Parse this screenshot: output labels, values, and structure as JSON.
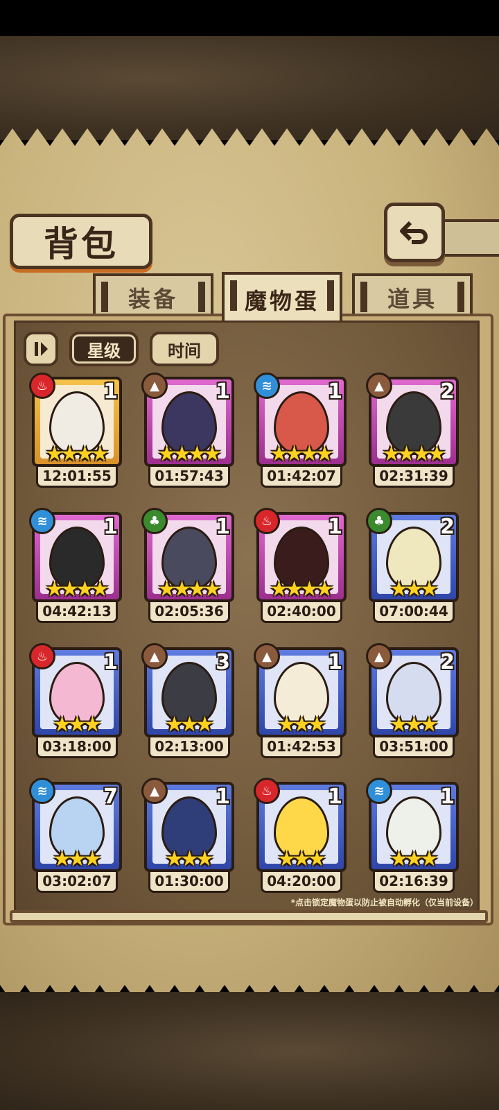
{
  "header": {
    "title": "背包",
    "back_icon": "return-arrow-icon"
  },
  "tabs": [
    {
      "label": "装备",
      "active": false
    },
    {
      "label": "魔物蛋",
      "active": true
    },
    {
      "label": "道具",
      "active": false
    }
  ],
  "sort": {
    "toggle_icon": "sort-direction-icon",
    "options": [
      {
        "label": "星级",
        "active": true
      },
      {
        "label": "时间",
        "active": false
      }
    ]
  },
  "eggs": [
    {
      "element": "fire",
      "frame": "gold",
      "count": "1",
      "stars": 4,
      "timer": "12:01:55",
      "egg_color": "#f0ece4"
    },
    {
      "element": "earth",
      "frame": "purple",
      "count": "1",
      "stars": 4,
      "timer": "01:57:43",
      "egg_color": "#3b3760"
    },
    {
      "element": "water",
      "frame": "purple",
      "count": "1",
      "stars": 4,
      "timer": "01:42:07",
      "egg_color": "#d8584a"
    },
    {
      "element": "earth",
      "frame": "purple",
      "count": "2",
      "stars": 4,
      "timer": "02:31:39",
      "egg_color": "#3a3a3a"
    },
    {
      "element": "water",
      "frame": "purple",
      "count": "1",
      "stars": 4,
      "timer": "04:42:13",
      "egg_color": "#2a2a2a"
    },
    {
      "element": "wood",
      "frame": "purple",
      "count": "1",
      "stars": 4,
      "timer": "02:05:36",
      "egg_color": "#4a4a5e"
    },
    {
      "element": "fire",
      "frame": "purple",
      "count": "1",
      "stars": 4,
      "timer": "02:40:00",
      "egg_color": "#3a1c1c"
    },
    {
      "element": "wood",
      "frame": "blue",
      "count": "2",
      "stars": 3,
      "timer": "07:00:44",
      "egg_color": "#efe8bf"
    },
    {
      "element": "fire",
      "frame": "blue",
      "count": "1",
      "stars": 3,
      "timer": "03:18:00",
      "egg_color": "#f4b8d2"
    },
    {
      "element": "earth",
      "frame": "blue",
      "count": "3",
      "stars": 3,
      "timer": "02:13:00",
      "egg_color": "#3c3c44"
    },
    {
      "element": "earth",
      "frame": "blue",
      "count": "1",
      "stars": 3,
      "timer": "01:42:53",
      "egg_color": "#f5ecd8"
    },
    {
      "element": "earth",
      "frame": "blue",
      "count": "2",
      "stars": 3,
      "timer": "03:51:00",
      "egg_color": "#d6dcf0"
    },
    {
      "element": "water",
      "frame": "blue",
      "count": "7",
      "stars": 3,
      "timer": "03:02:07",
      "egg_color": "#b9d4f2"
    },
    {
      "element": "earth",
      "frame": "blue",
      "count": "1",
      "stars": 3,
      "timer": "01:30:00",
      "egg_color": "#2f3d78"
    },
    {
      "element": "fire",
      "frame": "blue",
      "count": "1",
      "stars": 3,
      "timer": "04:20:00",
      "egg_color": "#ffd84a"
    },
    {
      "element": "water",
      "frame": "blue",
      "count": "1",
      "stars": 3,
      "timer": "02:16:39",
      "egg_color": "#eef0ea"
    }
  ],
  "hint": "*点击锁定魔物蛋以防止被自动孵化（仅当前设备）",
  "element_glyphs": {
    "fire": "♨",
    "earth": "▲",
    "water": "≋",
    "wood": "♣"
  }
}
